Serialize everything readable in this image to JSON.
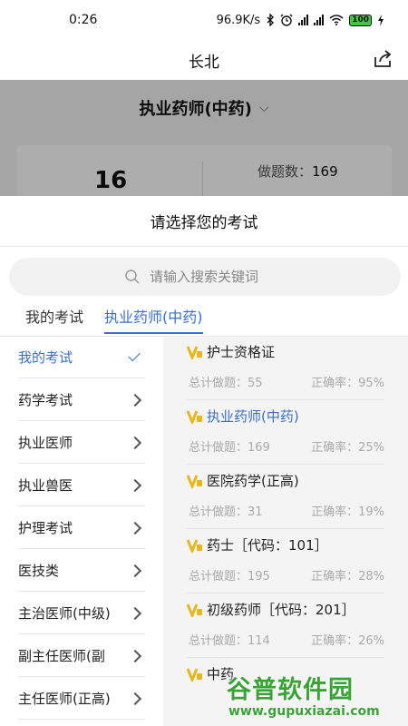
{
  "status_bar": {
    "time": "0:26",
    "network_speed": "96.9K/s",
    "battery": "100",
    "icons": [
      "bluetooth-icon",
      "alarm-icon",
      "signal-icon",
      "hd-signal-icon",
      "wifi-icon",
      "battery-icon",
      "charging-icon"
    ]
  },
  "header": {
    "title": "长北",
    "share_icon": "share-icon"
  },
  "background_page": {
    "exam_selector": "执业药师(中药)",
    "big_number": "16",
    "stat_label": "做题数：",
    "stat_value": "169"
  },
  "sheet": {
    "title": "请选择您的考试",
    "search": {
      "placeholder": "请输入搜索关键词"
    },
    "tabs": [
      {
        "label": "我的考试"
      },
      {
        "label": "执业药师(中药)",
        "active": true
      }
    ],
    "categories": [
      {
        "label": "我的考试",
        "active": true
      },
      {
        "label": "药学考试"
      },
      {
        "label": "执业医师"
      },
      {
        "label": "执业兽医"
      },
      {
        "label": "护理考试"
      },
      {
        "label": "医技类"
      },
      {
        "label": "主治医师(中级)"
      },
      {
        "label": "副主任医师(副"
      },
      {
        "label": "主任医师(正高)"
      }
    ],
    "exams": [
      {
        "name": "护士资格证",
        "total_label": "总计做题：55",
        "accuracy_label": "正确率：95%"
      },
      {
        "name": "执业药师(中药)",
        "total_label": "总计做题：169",
        "accuracy_label": "正确率：25%",
        "active": true
      },
      {
        "name": "医院药学(正高)",
        "total_label": "总计做题：31",
        "accuracy_label": "正确率：19%"
      },
      {
        "name": "药士［代码：101］",
        "total_label": "总计做题：195",
        "accuracy_label": "正确率：28%"
      },
      {
        "name": "初级药师［代码：201］",
        "total_label": "总计做题：114",
        "accuracy_label": "正确率：26%"
      },
      {
        "name": "中药"
      }
    ]
  },
  "watermark": {
    "title": "谷普软件园",
    "url": "www.gupuxiazai.com"
  },
  "colors": {
    "accent": "#3b6fc9",
    "vip_badge": "#e8b81a",
    "watermark": "#3aa335",
    "battery": "#49c34a"
  }
}
